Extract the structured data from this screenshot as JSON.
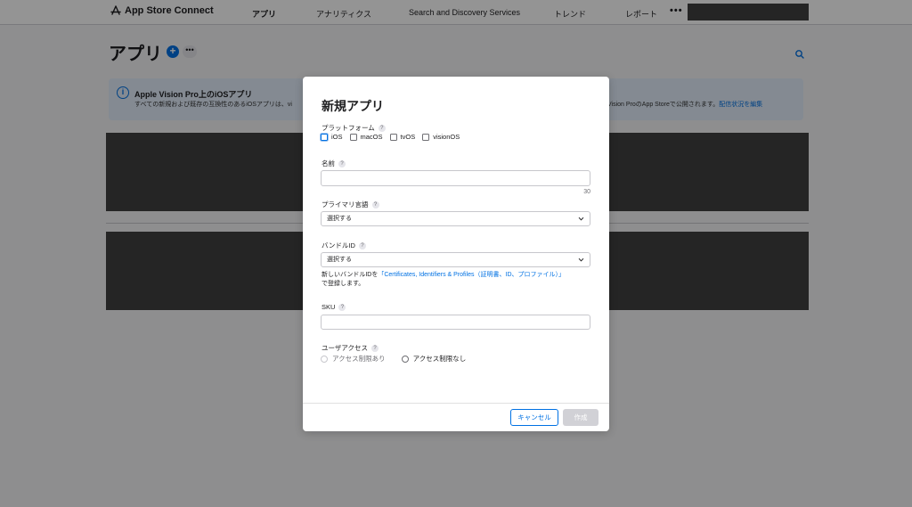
{
  "topnav": {
    "brand": "App Store Connect",
    "items": [
      "アプリ",
      "アナリティクス",
      "Search and Discovery Services",
      "トレンド",
      "レポート"
    ],
    "more": "•••"
  },
  "page": {
    "title": "アプリ",
    "add_label": "+",
    "more_label": "•••"
  },
  "banner": {
    "title": "Apple Vision Pro上のiOSアプリ",
    "text_left": "すべての新規および既存の互換性のあるiOSアプリは、vi",
    "text_right": "Vision ProのApp Storeで公開されます。",
    "link": "配信状況を編集"
  },
  "modal": {
    "title": "新規アプリ",
    "platform_label": "プラットフォーム",
    "platforms": [
      "iOS",
      "macOS",
      "tvOS",
      "visionOS"
    ],
    "name_label": "名前",
    "name_value": "",
    "name_counter": "30",
    "language_label": "プライマリ言語",
    "language_value": "選択する",
    "bundle_label": "バンドルID",
    "bundle_value": "選択する",
    "bundle_hint_prefix": "新しいバンドルIDを",
    "bundle_hint_link": "「Certificates, Identifiers & Profiles（証明書、ID、プロファイル）」",
    "bundle_hint_suffix": "で登録します。",
    "sku_label": "SKU",
    "sku_value": "",
    "access_label": "ユーザアクセス",
    "access_options": [
      "アクセス制限あり",
      "アクセス制限なし"
    ],
    "help_glyph": "?",
    "cancel_label": "キャンセル",
    "create_label": "作成"
  },
  "colors": {
    "accent": "#0071e3",
    "overlay": "#909090",
    "redacted": "#404040"
  }
}
